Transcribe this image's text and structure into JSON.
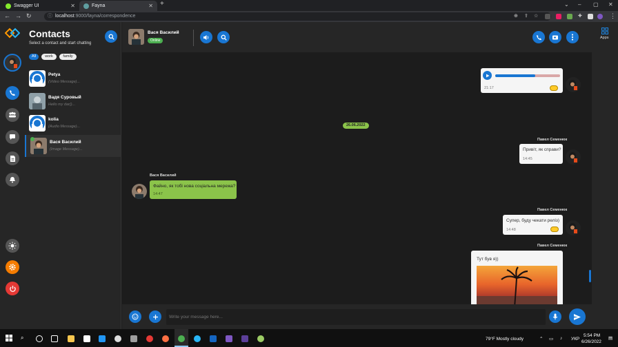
{
  "browser": {
    "tabs": [
      {
        "title": "Swagger UI",
        "active": false
      },
      {
        "title": "Fayna",
        "active": true
      }
    ],
    "url_host": "localhost",
    "url_rest": ":9000/fayna/correspondence",
    "window_controls": {
      "minimize": "–",
      "maximize": "▢",
      "close": "✕"
    },
    "new_tab": "+"
  },
  "sidebar": {
    "title": "Contacts",
    "subtitle": "Select a contact and start chatting",
    "filters": [
      "All",
      "work",
      "family"
    ],
    "active_filter": "All"
  },
  "contacts": [
    {
      "name": "Petya",
      "preview": "(Video Message)...",
      "avatar": "placeholder"
    },
    {
      "name": "Вадя Суровый",
      "preview": "Hello my dar()...",
      "avatar": "photo"
    },
    {
      "name": "kolia",
      "preview": "(Audio Message)...",
      "avatar": "placeholder"
    },
    {
      "name": "Вася Василий",
      "preview": "(Image Message)...",
      "avatar": "photo",
      "active": true
    }
  ],
  "chat_header": {
    "name": "Вася Василий",
    "status": "Online"
  },
  "messages": {
    "audio": {
      "time": "21:17",
      "progress": 0.62
    },
    "date_separator": "26.06.2022",
    "m1": {
      "sender": "Павел Семенюк",
      "text": "Привіт, як справи?",
      "time": "14:45"
    },
    "m2": {
      "sender": "Вася Василий",
      "text": "Файно, як тобі нова соціальна мережа?",
      "time": "14:47"
    },
    "m3": {
      "sender": "Павел Семенюк",
      "text": "Супер, буду чекати реліз)",
      "time": "14:48"
    },
    "m4": {
      "sender": "Павел Семенюк",
      "text": "Тут був я))"
    }
  },
  "composer": {
    "placeholder": "Write your message here..."
  },
  "right_panel": {
    "apps_label": "Apps"
  },
  "taskbar": {
    "weather": "79°F  Mostly cloudy",
    "lang": "УКР",
    "time": "5:54 PM",
    "date": "6/26/2022"
  },
  "colors": {
    "accent": "#1976d2",
    "online": "#4caf50",
    "incoming_bubble": "#8bc34a"
  }
}
